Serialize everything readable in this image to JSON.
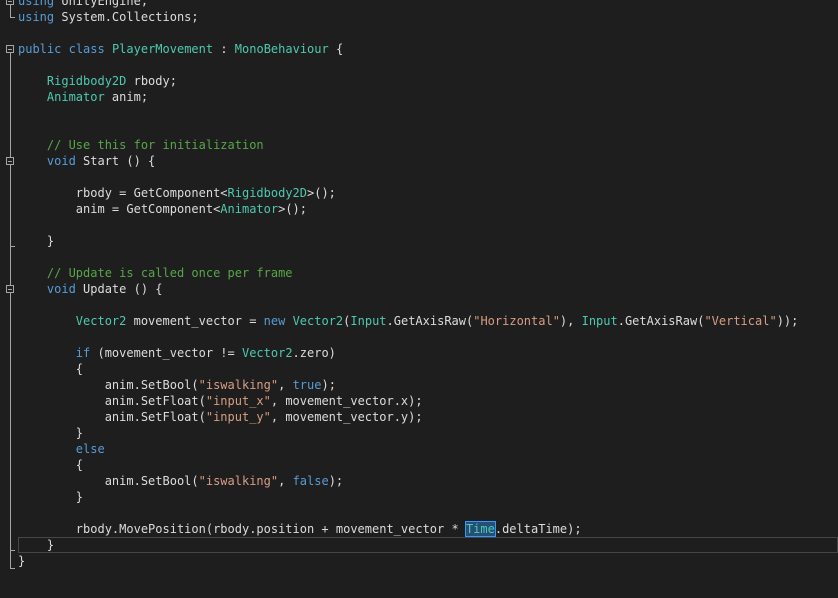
{
  "editor": {
    "language": "csharp",
    "colors": {
      "background": "#1e1e1e",
      "text": "#dcdcdc",
      "keyword": "#569cd6",
      "type": "#4ec9b0",
      "string": "#d69d85",
      "comment": "#57a64a",
      "selection": "#264f78"
    },
    "current_line": 34,
    "selected_token": "Time",
    "lines": [
      [
        [
          "kw",
          "using"
        ],
        [
          "id",
          " UnityEngine;"
        ]
      ],
      [
        [
          "kw",
          "using"
        ],
        [
          "id",
          " System.Collections;"
        ]
      ],
      [],
      [
        [
          "kw",
          "public"
        ],
        [
          "id",
          " "
        ],
        [
          "kw",
          "class"
        ],
        [
          "id",
          " "
        ],
        [
          "ty",
          "PlayerMovement"
        ],
        [
          "id",
          " : "
        ],
        [
          "ty",
          "MonoBehaviour"
        ],
        [
          "id",
          " {"
        ]
      ],
      [],
      [
        [
          "ty",
          "    Rigidbody2D"
        ],
        [
          "id",
          " rbody;"
        ]
      ],
      [
        [
          "ty",
          "    Animator"
        ],
        [
          "id",
          " anim;"
        ]
      ],
      [],
      [],
      [
        [
          "cm",
          "    // Use this for initialization"
        ]
      ],
      [
        [
          "kw",
          "    void"
        ],
        [
          "id",
          " Start () {"
        ]
      ],
      [],
      [
        [
          "id",
          "        rbody = GetComponent<"
        ],
        [
          "ty",
          "Rigidbody2D"
        ],
        [
          "id",
          ">();"
        ]
      ],
      [
        [
          "id",
          "        anim = GetComponent<"
        ],
        [
          "ty",
          "Animator"
        ],
        [
          "id",
          ">();"
        ]
      ],
      [],
      [
        [
          "id",
          "    }"
        ]
      ],
      [],
      [
        [
          "cm",
          "    // Update is called once per frame"
        ]
      ],
      [
        [
          "kw",
          "    void"
        ],
        [
          "id",
          " Update () {"
        ]
      ],
      [],
      [
        [
          "ty",
          "        Vector2"
        ],
        [
          "id",
          " movement_vector = "
        ],
        [
          "kw",
          "new"
        ],
        [
          "id",
          " "
        ],
        [
          "ty",
          "Vector2"
        ],
        [
          "id",
          "("
        ],
        [
          "ty",
          "Input"
        ],
        [
          "id",
          ".GetAxisRaw("
        ],
        [
          "str",
          "\"Horizontal\""
        ],
        [
          "id",
          "), "
        ],
        [
          "ty",
          "Input"
        ],
        [
          "id",
          ".GetAxisRaw("
        ],
        [
          "str",
          "\"Vertical\""
        ],
        [
          "id",
          "));"
        ]
      ],
      [],
      [
        [
          "kw",
          "        if"
        ],
        [
          "id",
          " (movement_vector != "
        ],
        [
          "ty",
          "Vector2"
        ],
        [
          "id",
          ".zero)"
        ]
      ],
      [
        [
          "id",
          "        {"
        ]
      ],
      [
        [
          "id",
          "            anim.SetBool("
        ],
        [
          "str",
          "\"iswalking\""
        ],
        [
          "id",
          ", "
        ],
        [
          "kw",
          "true"
        ],
        [
          "id",
          ");"
        ]
      ],
      [
        [
          "id",
          "            anim.SetFloat("
        ],
        [
          "str",
          "\"input_x\""
        ],
        [
          "id",
          ", movement_vector.x);"
        ]
      ],
      [
        [
          "id",
          "            anim.SetFloat("
        ],
        [
          "str",
          "\"input_y\""
        ],
        [
          "id",
          ", movement_vector.y);"
        ]
      ],
      [
        [
          "id",
          "        }"
        ]
      ],
      [
        [
          "kw",
          "        else"
        ]
      ],
      [
        [
          "id",
          "        {"
        ]
      ],
      [
        [
          "id",
          "            anim.SetBool("
        ],
        [
          "str",
          "\"iswalking\""
        ],
        [
          "id",
          ", "
        ],
        [
          "kw",
          "false"
        ],
        [
          "id",
          ");"
        ]
      ],
      [
        [
          "id",
          "        }"
        ]
      ],
      [],
      [
        [
          "id",
          "        rbody.MovePosition(rbody.position + movement_vector * "
        ],
        [
          "sel",
          "Time"
        ],
        [
          "id",
          ".deltaTime);"
        ]
      ],
      [
        [
          "id",
          "    }"
        ]
      ],
      [
        [
          "id",
          "}"
        ]
      ]
    ]
  }
}
